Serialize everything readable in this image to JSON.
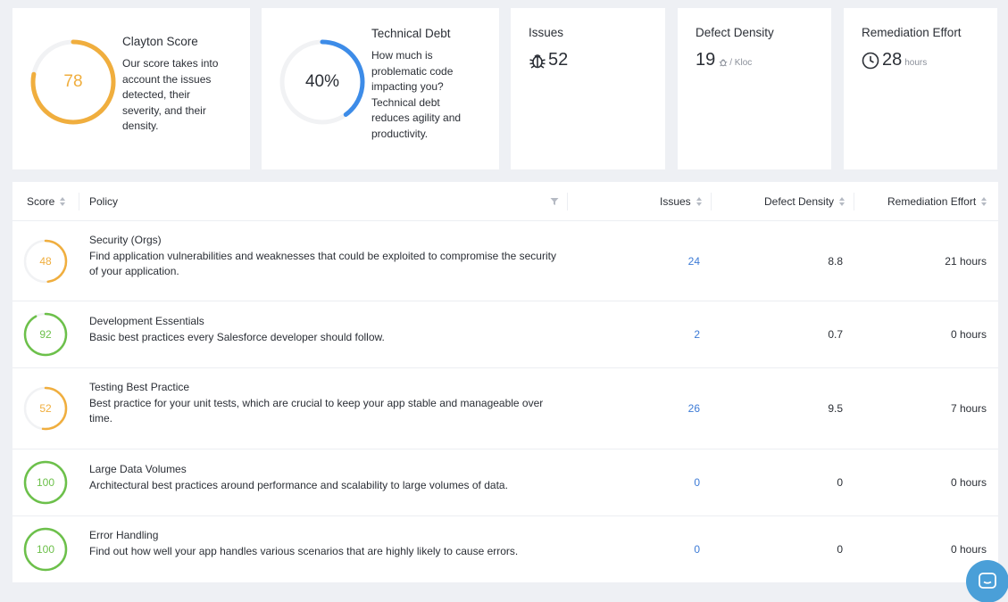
{
  "summary": {
    "clayton_score": {
      "title": "Clayton Score",
      "value": "78",
      "percent": 78,
      "description": "Our score takes into account the issues detected, their severity, and their density.",
      "color": "#f0ae3e"
    },
    "technical_debt": {
      "title": "Technical Debt",
      "value": "40%",
      "percent": 40,
      "description": "How much is problematic code impacting you? Technical debt reduces agility and productivity.",
      "color": "#3d8ce8"
    },
    "issues": {
      "title": "Issues",
      "value": "52",
      "icon": "bug-icon"
    },
    "defect_density": {
      "title": "Defect Density",
      "value": "19",
      "unit": "/ Kloc",
      "icon": "bug-icon"
    },
    "remediation_effort": {
      "title": "Remediation Effort",
      "value": "28",
      "unit": "hours",
      "icon": "clock-icon"
    }
  },
  "table": {
    "headers": {
      "score": "Score",
      "policy": "Policy",
      "issues": "Issues",
      "defect_density": "Defect Density",
      "remediation_effort": "Remediation Effort"
    },
    "rows": [
      {
        "score": "48",
        "percent": 48,
        "color": "#f0ae3e",
        "name": "Security (Orgs)",
        "description": "Find application vulnerabilities and weaknesses that could be exploited to compromise the security of your application.",
        "issues": "24",
        "defect_density": "8.8",
        "remediation": "21 hours"
      },
      {
        "score": "92",
        "percent": 92,
        "color": "#6cc04a",
        "name": "Development Essentials",
        "description": "Basic best practices every Salesforce developer should follow.",
        "issues": "2",
        "defect_density": "0.7",
        "remediation": "0 hours"
      },
      {
        "score": "52",
        "percent": 52,
        "color": "#f0ae3e",
        "name": "Testing Best Practice",
        "description": "Best practice for your unit tests, which are crucial to keep your app stable and manageable over time.",
        "issues": "26",
        "defect_density": "9.5",
        "remediation": "7 hours"
      },
      {
        "score": "100",
        "percent": 100,
        "color": "#6cc04a",
        "name": "Large Data Volumes",
        "description": "Architectural best practices around performance and scalability to large volumes of data.",
        "issues": "0",
        "defect_density": "0",
        "remediation": "0 hours"
      },
      {
        "score": "100",
        "percent": 100,
        "color": "#6cc04a",
        "name": "Error Handling",
        "description": "Find out how well your app handles various scenarios that are highly likely to cause errors.",
        "issues": "0",
        "defect_density": "0",
        "remediation": "0 hours"
      }
    ]
  },
  "chat_widget": {
    "icon": "chat-icon",
    "color": "#4a9fd8"
  }
}
